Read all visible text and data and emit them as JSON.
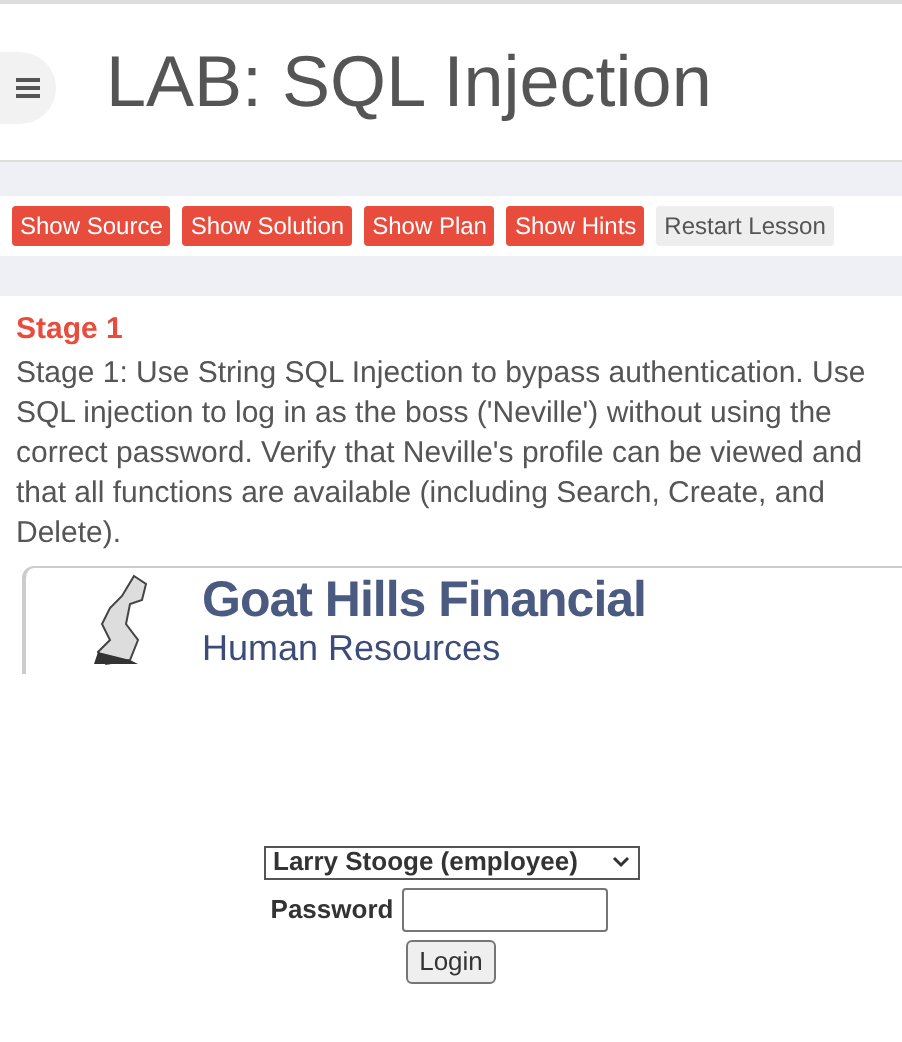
{
  "header": {
    "title": "LAB: SQL Injection"
  },
  "buttons": [
    {
      "label": "Show Source",
      "kind": "primary"
    },
    {
      "label": "Show Solution",
      "kind": "primary"
    },
    {
      "label": "Show Plan",
      "kind": "primary"
    },
    {
      "label": "Show Hints",
      "kind": "primary"
    },
    {
      "label": "Restart Lesson",
      "kind": "secondary"
    }
  ],
  "stage": {
    "title": "Stage 1",
    "description": "Stage 1: Use String SQL Injection to bypass authentication. Use SQL injection to log in as the boss ('Neville') without using the correct password. Verify that Neville's profile can be viewed and that all functions are available (including Search, Create, and Delete)."
  },
  "banner": {
    "company": "Goat Hills Financial",
    "department": "Human Resources"
  },
  "login": {
    "user": "Larry Stooge (employee)",
    "password_label": "Password",
    "button": "Login"
  }
}
